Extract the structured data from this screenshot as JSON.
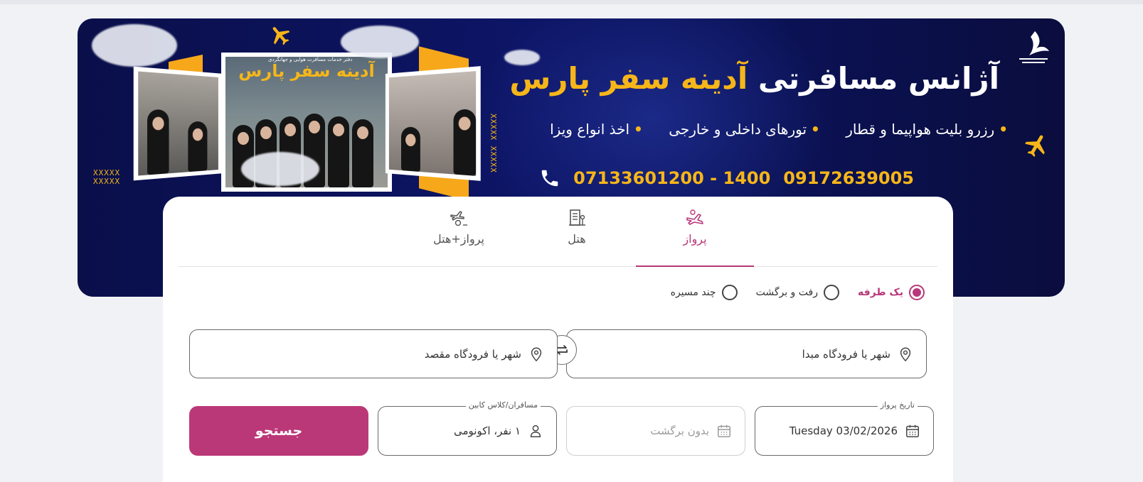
{
  "banner": {
    "title_main": "آژانس مسافرتی",
    "title_brand": "آدینه سفر پارس",
    "services": [
      "رزرو بلیت هواپیما و قطار",
      "تورهای داخلی و خارجی",
      "اخذ انواع ویزا"
    ],
    "phone_landline": "07133601200 - 1400",
    "phone_mobile": "09172639005",
    "sign_text": "آدینه سفر پارس",
    "sign_sub": "دفتر خدمات مسافرت هوایی و جهانگردی",
    "logo_text": "آدینه سفر پارس",
    "accent_color": "#f6b619",
    "bg_color": "#0b1256"
  },
  "tabs": [
    {
      "label": "پرواز",
      "icon": "flight-icon",
      "active": true
    },
    {
      "label": "هتل",
      "icon": "hotel-icon",
      "active": false
    },
    {
      "label": "پرواز+هتل",
      "icon": "flight-hotel-icon",
      "active": false
    }
  ],
  "trip_type": {
    "options": [
      "یک طرفه",
      "رفت و برگشت",
      "چند مسیره"
    ],
    "selected": "یک طرفه"
  },
  "origin": {
    "placeholder": "شهر یا فرودگاه مبدا"
  },
  "destination": {
    "placeholder": "شهر یا فرودگاه مقصد"
  },
  "departure_date": {
    "label": "تاریخ پرواز",
    "value": "Tuesday 03/02/2026"
  },
  "return_date": {
    "value": "بدون برگشت"
  },
  "passengers": {
    "label": "مسافران/کلاس کابین",
    "value": "۱ نفر، اکونومی"
  },
  "search_button": {
    "label": "جستجو"
  },
  "colors": {
    "primary": "#bb3878",
    "tab_active": "#b8387a"
  }
}
